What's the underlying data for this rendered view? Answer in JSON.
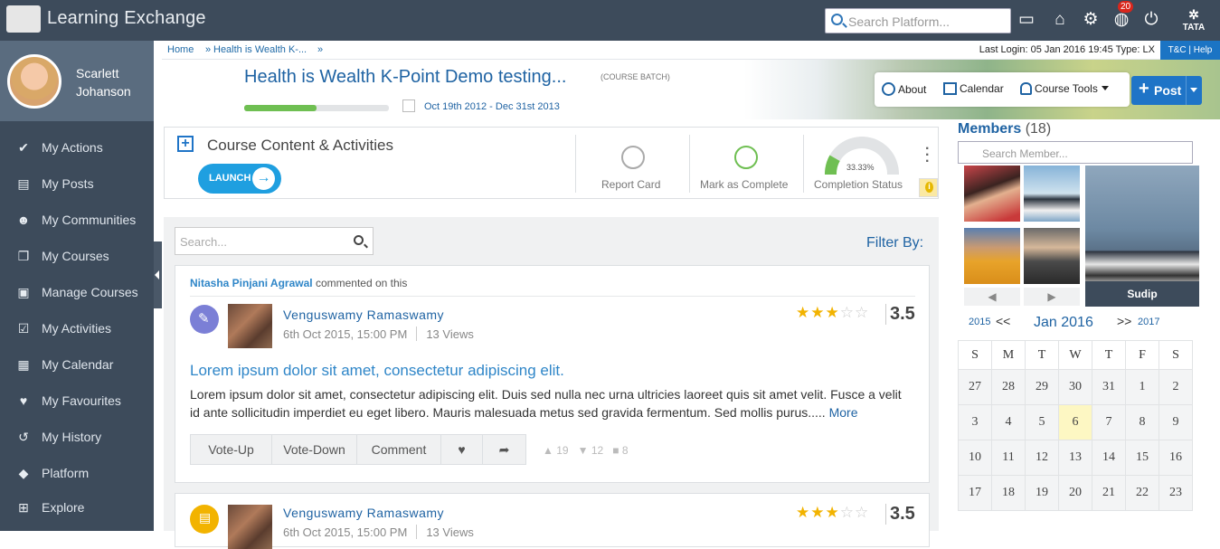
{
  "app": {
    "title": "Learning Exchange",
    "search_placeholder": "Search Platform...",
    "notifications": "20",
    "brand": "TATA"
  },
  "user": {
    "first": "Scarlett",
    "last": "Johanson"
  },
  "sidebar": {
    "items": [
      {
        "label": "My Actions",
        "icon": "user-check-icon"
      },
      {
        "label": "My Posts",
        "icon": "document-icon"
      },
      {
        "label": "My Communities",
        "icon": "users-icon"
      },
      {
        "label": "My Courses",
        "icon": "book-icon"
      },
      {
        "label": "Manage Courses",
        "icon": "manage-icon"
      },
      {
        "label": "My Activities",
        "icon": "activity-icon"
      },
      {
        "label": "My Calendar",
        "icon": "calendar-icon"
      },
      {
        "label": "My Favourites",
        "icon": "heart-icon"
      },
      {
        "label": "My History",
        "icon": "history-icon"
      },
      {
        "label": "Platform",
        "icon": "cube-icon"
      },
      {
        "label": "Explore",
        "icon": "explore-icon"
      }
    ]
  },
  "breadcrumb": {
    "home": "Home",
    "sep": "»",
    "current": "Health is Wealth K-...",
    "trail_sep": "»"
  },
  "login_info": "Last Login: 05 Jan 2016 19:45 Type: LX",
  "tnc": "T&C | Help",
  "course": {
    "title": "Health is Wealth K-Point Demo testing...",
    "tag": "(COURSE BATCH)",
    "dates": "Oct 19th 2012 - Dec 31st 2013",
    "progress": 0.5
  },
  "course_actions": {
    "about": "About",
    "calendar": "Calendar",
    "tools": "Course Tools",
    "post": "Post"
  },
  "content": {
    "title": "Course Content & Activities",
    "launch": "LAUNCH",
    "report": "Report Card",
    "complete": "Mark as Complete",
    "status": "Completion Status",
    "completion": "33.33%"
  },
  "feed": {
    "search_placeholder": "Search...",
    "filter": "Filter By:"
  },
  "posts": [
    {
      "commenter": "Nitasha Pinjani Agrawal",
      "comment_text": "commented on this",
      "author": "Venguswamy Ramaswamy",
      "date": "6th Oct 2015, 15:00 PM",
      "views": "13 Views",
      "rating": "3.5",
      "title": "Lorem ipsum dolor sit amet, consectetur adipiscing elit.",
      "body": "Lorem ipsum dolor sit amet, consectetur adipiscing elit. Duis sed nulla nec urna ultricies laoreet quis sit amet velit. Fusce a velit id ante sollicitudin imperdiet eu eget libero. Mauris malesuada metus sed gravida fermentum. Sed mollis purus.....",
      "more": "More",
      "vote_up": "Vote-Up",
      "vote_down": "Vote-Down",
      "comment": "Comment",
      "likes": "19",
      "dislikes": "12",
      "comments": "8",
      "badge_color": "#7b7fd6"
    },
    {
      "author": "Venguswamy Ramaswamy",
      "date": "6th Oct 2015, 15:00 PM",
      "views": "13 Views",
      "rating": "3.5",
      "badge_color": "#f2b300"
    }
  ],
  "members": {
    "title": "Members",
    "count": "(18)",
    "search_placeholder": "Search Member...",
    "featured": "Sudip"
  },
  "calendar": {
    "prev_year": "2015",
    "prev": "<<",
    "month": "Jan 2016",
    "next": ">>",
    "next_year": "2017",
    "days": [
      "S",
      "M",
      "T",
      "W",
      "T",
      "F",
      "S"
    ],
    "weeks": [
      [
        "27",
        "28",
        "29",
        "30",
        "31",
        "1",
        "2"
      ],
      [
        "3",
        "4",
        "5",
        "6",
        "7",
        "8",
        "9"
      ],
      [
        "10",
        "11",
        "12",
        "13",
        "14",
        "15",
        "16"
      ],
      [
        "17",
        "18",
        "19",
        "20",
        "21",
        "22",
        "23"
      ]
    ],
    "today": "6"
  }
}
